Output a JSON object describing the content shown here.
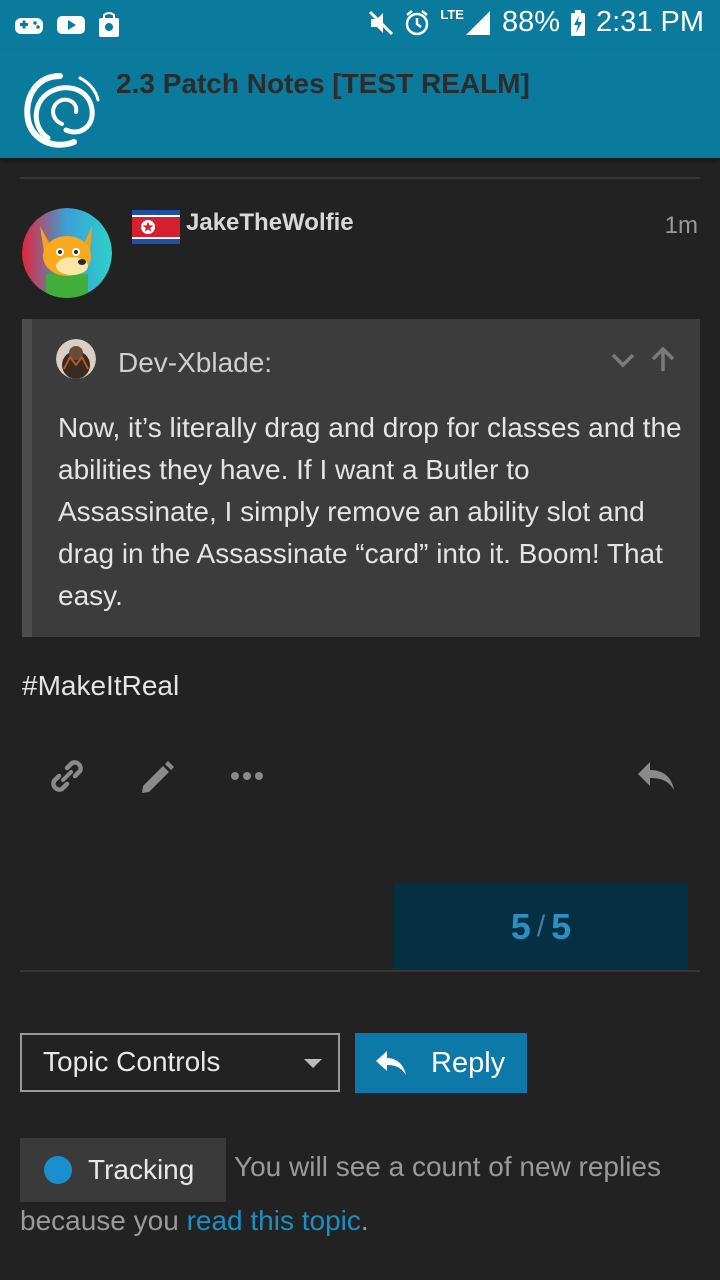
{
  "status_bar": {
    "lte": "LTE",
    "battery": "88%",
    "time": "2:31 PM"
  },
  "header": {
    "title": "2.3 Patch Notes [TEST REALM]"
  },
  "post": {
    "username": "JakeTheWolfie",
    "time": "1m",
    "quote": {
      "author": "Dev-Xblade:",
      "text": "Now, it’s literally drag and drop for classes and the abilities they have. If I want a Butler to Assassinate, I simply remove an ability slot and drag in the Assassinate “card” into it. Boom! That easy."
    },
    "body": "#MakeItReal"
  },
  "progress": {
    "current": "5",
    "separator": "/",
    "total": "5"
  },
  "controls": {
    "topic_controls_label": "Topic Controls",
    "reply_label": "Reply"
  },
  "tracking": {
    "label": "Tracking",
    "desc_before": "You will see a count of new replies",
    "desc_line2": "because you",
    "link": "read this topic",
    "period": "."
  },
  "colors": {
    "header_bg": "#0a7a9d",
    "background": "#222222",
    "accent": "#0c79a8",
    "link": "#1a8fc4"
  }
}
